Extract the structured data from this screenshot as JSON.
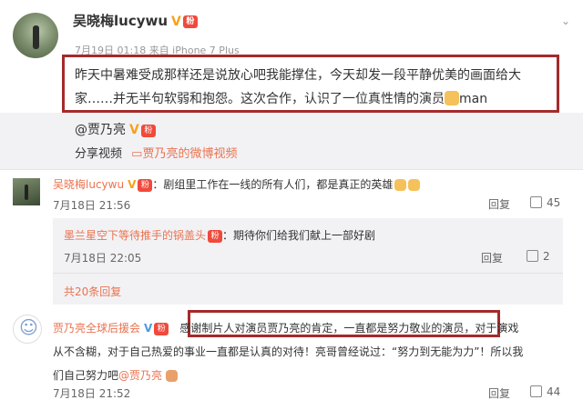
{
  "post": {
    "username": "吴晓梅lucywu",
    "verified_mark": "V",
    "meta": "7月19日 01:18 来自 iPhone 7 Plus",
    "body": "昨天中暑难受成那样还是说放心吧我能撑住，今天却发一段平静优美的画面给大家……并无半句软弱和抱怨。这次合作，认识了一位真性情的演员",
    "body_tail": "man",
    "mention": "@贾乃亮",
    "share_label": "分享视频",
    "weibo_video_link": "贾乃亮的微博视频",
    "menu_icon": "chevron-down-icon"
  },
  "comments": [
    {
      "name": "吴晓梅lucywu",
      "text": "：剧组里工作在一线的所有人们，都是真正的英雄",
      "date": "7月18日 21:56",
      "reply_label": "回复",
      "likes": "45"
    },
    {
      "name": "墨兰星空下等待推手的锅盖头",
      "text": "：期待你们给我们献上一部好剧",
      "date": "7月18日 22:05",
      "reply_label": "回复",
      "likes": "2"
    },
    {
      "name": "贾乃亮全球后援会",
      "text_highlight": "感谢制片人对演员贾乃亮的肯定，一直都是努力敬业的演员",
      "text_rest_1": "，对于演戏",
      "text_rest_2": "从不含糊，对于自己热爱的事业一直都是认真的对待！亮哥曾经说过：“努力到无能为力”！所以我",
      "text_rest_3": "们自己努力吧",
      "mention": "@贾乃亮",
      "date": "7月18日 21:52",
      "reply_label": "回复",
      "likes": "44"
    }
  ],
  "more_replies": "共20条回复",
  "colors": {
    "accent": "#eb7350",
    "highlight_box": "#a52a2a",
    "verified": "#f7a21b"
  }
}
